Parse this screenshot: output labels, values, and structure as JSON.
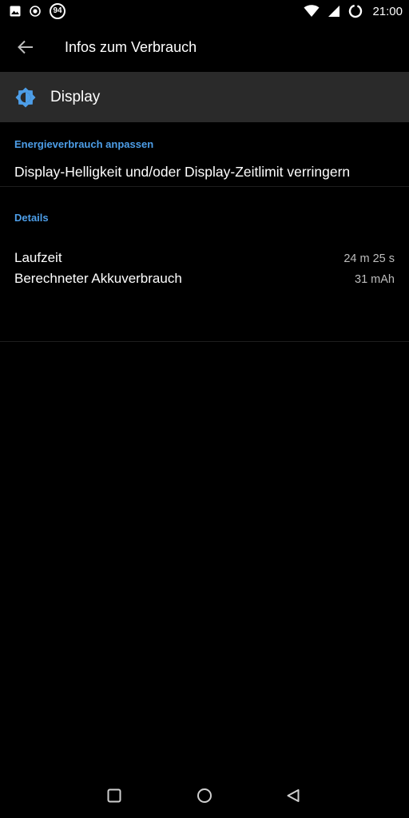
{
  "status_bar": {
    "notifications": [
      "image-icon",
      "record-icon",
      "badge-94-icon"
    ],
    "badge_text": "94",
    "time": "21:00"
  },
  "app_bar": {
    "title": "Infos zum Verbrauch"
  },
  "header": {
    "app_name": "Display",
    "icon": "brightness-gear-icon",
    "accent_color": "#4d9ee8"
  },
  "sections": {
    "tips_title": "Energieverbrauch anpassen",
    "tip_text": "Display-Helligkeit und/oder Display-Zeitlimit verringern",
    "details_title": "Details"
  },
  "details": [
    {
      "label": "Laufzeit",
      "value": "24 m 25 s"
    },
    {
      "label": "Berechneter Akkuverbrauch",
      "value": "31 mAh"
    }
  ],
  "nav": [
    "recents-square-icon",
    "home-circle-icon",
    "back-triangle-icon"
  ]
}
